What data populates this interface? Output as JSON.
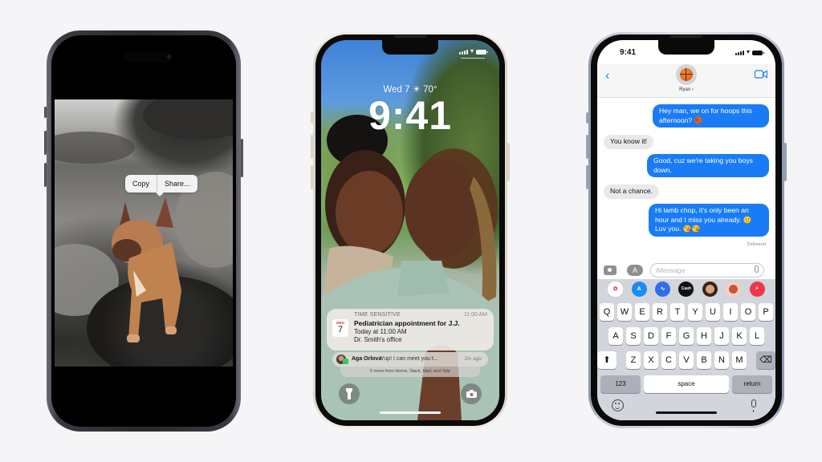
{
  "background_color": "#f5f5f7",
  "phones": {
    "left": {
      "frame_color": "space-black",
      "photo_subject": "french bulldog on rocky beach",
      "context_menu": {
        "items": [
          "Copy",
          "Share..."
        ]
      }
    },
    "center": {
      "frame_color": "starlight",
      "lock_screen": {
        "date_weather": "Wed 7  ☀ 70°",
        "time": "9:41",
        "wallpaper_subject": "mother and daughter portrait",
        "notification": {
          "category": "TIME SENSITIVE",
          "time": "11:00 AM",
          "calendar_month": "WED",
          "calendar_day": "7",
          "title": "Pediatrician appointment for J.J.",
          "line2": "Today at 11:00 AM",
          "line3": "Dr. Smith's office"
        },
        "message_notification": {
          "sender": "Aga Orlova",
          "preview": "Yup! I can meet you t...",
          "time_ago": "2m ago"
        },
        "more_notifications": "6 more from Home, Slack, Mail, and Yelp",
        "flashlight_icon": "🔦",
        "camera_icon": "📷"
      }
    },
    "right": {
      "frame_color": "blue",
      "status_time": "9:41",
      "contact_name": "Ryan ›",
      "accent_color": "#1a7cf5",
      "messages": [
        {
          "dir": "out",
          "text": "Hey man, we on for hoops this afternoon? 🏀"
        },
        {
          "dir": "in",
          "text": "You know it!"
        },
        {
          "dir": "out",
          "text": "Good, cuz we're taking you boys down."
        },
        {
          "dir": "in",
          "text": "Not a chance."
        },
        {
          "dir": "out",
          "text": "Hi lamb chop, it's only been an hour and I miss you already. 🙂 Luv you. 😘😘"
        }
      ],
      "delivered_label": "Delivered",
      "input_placeholder": "iMessage",
      "app_strip": [
        {
          "name": "photos",
          "label": "✿",
          "color": "#ffffff"
        },
        {
          "name": "app-store",
          "label": "A",
          "color": "#1a8cf5"
        },
        {
          "name": "audio",
          "label": "∿",
          "color": "#2f6df0"
        },
        {
          "name": "apple-cash",
          "label": "Cash",
          "color": "#111111"
        },
        {
          "name": "memoji-1",
          "label": "",
          "color": "#6b4a34"
        },
        {
          "name": "memoji-2",
          "label": "",
          "color": "#c5563b"
        },
        {
          "name": "images-search",
          "label": "⌕",
          "color": "#f0364a"
        }
      ],
      "keyboard": {
        "row1": [
          "Q",
          "W",
          "E",
          "R",
          "T",
          "Y",
          "U",
          "I",
          "O",
          "P"
        ],
        "row2": [
          "A",
          "S",
          "D",
          "F",
          "G",
          "H",
          "J",
          "K",
          "L"
        ],
        "row3": [
          "Z",
          "X",
          "C",
          "V",
          "B",
          "N",
          "M"
        ],
        "shift": "⬆",
        "delete": "⌫",
        "numbers": "123",
        "space": "space",
        "return": "return"
      }
    }
  }
}
